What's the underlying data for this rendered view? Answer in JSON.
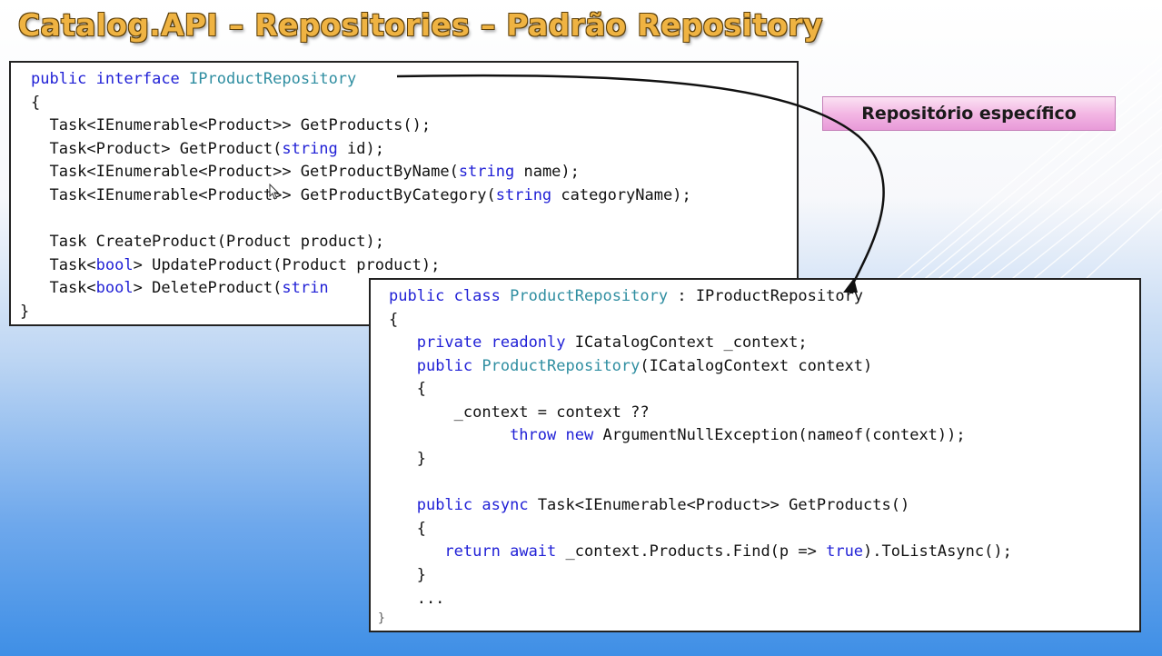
{
  "slide": {
    "title": "Catalog.API – Repositories – Padrão Repository",
    "label": "Repositório específico"
  },
  "interface_code": {
    "l1": {
      "a": "public",
      "b": " ",
      "c": "interface",
      "d": " ",
      "e": "IProductRepository"
    },
    "l2": "{",
    "l3": "  Task<IEnumerable<Product>> GetProducts();",
    "l4": {
      "a": "  Task<Product> GetProduct(",
      "b": "string",
      "c": " id);"
    },
    "l5": {
      "a": "  Task<IEnumerable<Product>> GetProductByName(",
      "b": "string",
      "c": " name);"
    },
    "l6": {
      "a": "  Task<IEnumerable<Product>> GetProductByCategory(",
      "b": "string",
      "c": " categoryName);"
    },
    "l7": "  Task CreateProduct(Product product);",
    "l8": {
      "a": "  Task<",
      "b": "bool",
      "c": "> UpdateProduct(Product product);"
    },
    "l9": {
      "a": "  Task<",
      "b": "bool",
      "c": "> DeleteProduct(",
      "d": "strin"
    },
    "l10": "}"
  },
  "class_code": {
    "l1": {
      "a": "public",
      "b": " ",
      "c": "class",
      "d": " ",
      "e": "ProductRepository",
      "f": " : IProductRepository"
    },
    "l2": "{",
    "l3": {
      "a": "   ",
      "b": "private",
      "c": " ",
      "d": "readonly",
      "e": " ICatalogContext _context;"
    },
    "l4": {
      "a": "   ",
      "b": "public",
      "c": " ",
      "d": "ProductRepository",
      "e": "(ICatalogContext context)"
    },
    "l5": "   {",
    "l6": "       _context = context ??",
    "l7": {
      "a": "             ",
      "b": "throw",
      "c": " ",
      "d": "new",
      "e": " ArgumentNullException(nameof(context));"
    },
    "l8": "   }",
    "l9": {
      "a": "   ",
      "b": "public",
      "c": " ",
      "d": "async",
      "e": " Task<IEnumerable<Product>> GetProducts()"
    },
    "l10": "   {",
    "l11": {
      "a": "      ",
      "b": "return",
      "c": " ",
      "d": "await",
      "e": " _context.Products.Find(p => ",
      "f": "true",
      "g": ").ToListAsync();"
    },
    "l12": "   }",
    "l13": "   ...",
    "l14": "}"
  },
  "colors": {
    "keyword": "#1f1fd6",
    "type_name": "#2f8ea1",
    "title": "#efb342",
    "label_bg": "#f3b7e4"
  },
  "icons": [
    "cursor-icon",
    "arrow-connector"
  ]
}
